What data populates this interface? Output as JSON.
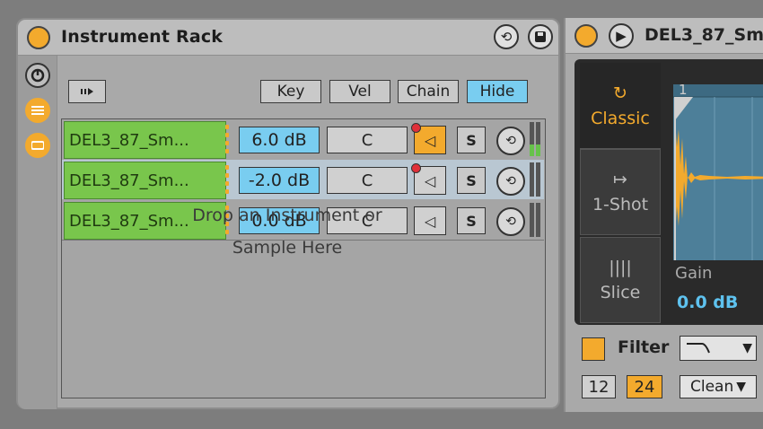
{
  "colors": {
    "accent": "#f3aa2d",
    "active_blue": "#79cdf0",
    "chain_green": "#79c64c",
    "gain_text": "#5ec2ef"
  },
  "rack": {
    "title": "Instrument Rack",
    "icons": {
      "activator": "device-on-icon",
      "hotswap": "hot-swap-icon",
      "save": "save-preset-icon",
      "macro": "macro-toggle-icon",
      "chain_list": "chain-list-icon",
      "device": "device-view-icon",
      "autoselect": "auto-select-icon"
    },
    "tabs": [
      "Key",
      "Vel",
      "Chain",
      "Hide"
    ],
    "active_tab": "Hide",
    "chains": [
      {
        "name": "DEL3_87_Sm...",
        "volume": "6.0 dB",
        "pan": "C",
        "solo": "S",
        "muted_highlight": true,
        "meter": [
          0.35,
          0.35
        ]
      },
      {
        "name": "DEL3_87_Sm...",
        "volume": "-2.0 dB",
        "pan": "C",
        "solo": "S",
        "muted_highlight": false,
        "meter": [
          0.0,
          0.0
        ]
      },
      {
        "name": "DEL3_87_Sm...",
        "volume": "0.0 dB",
        "pan": "C",
        "solo": "S",
        "muted_highlight": false,
        "meter": [
          0.0,
          0.0
        ]
      }
    ],
    "drop_hint_line1": "Drop an Instrument or",
    "drop_hint_line2": "Sample Here"
  },
  "simpler": {
    "title": "DEL3_87_Sm",
    "modes": [
      {
        "label": "Classic",
        "icon": "loop-icon",
        "glyph": "↻"
      },
      {
        "label": "1-Shot",
        "icon": "one-shot-icon",
        "glyph": "↦"
      },
      {
        "label": "Slice",
        "icon": "slice-icon",
        "glyph": "||||"
      }
    ],
    "active_mode": "Classic",
    "marker": "1",
    "gain_label": "Gain",
    "gain_value": "0.0 dB",
    "filter_label": "Filter",
    "slope_12": "12",
    "slope_24": "24",
    "active_slope": "24",
    "circuit": "Clean"
  }
}
